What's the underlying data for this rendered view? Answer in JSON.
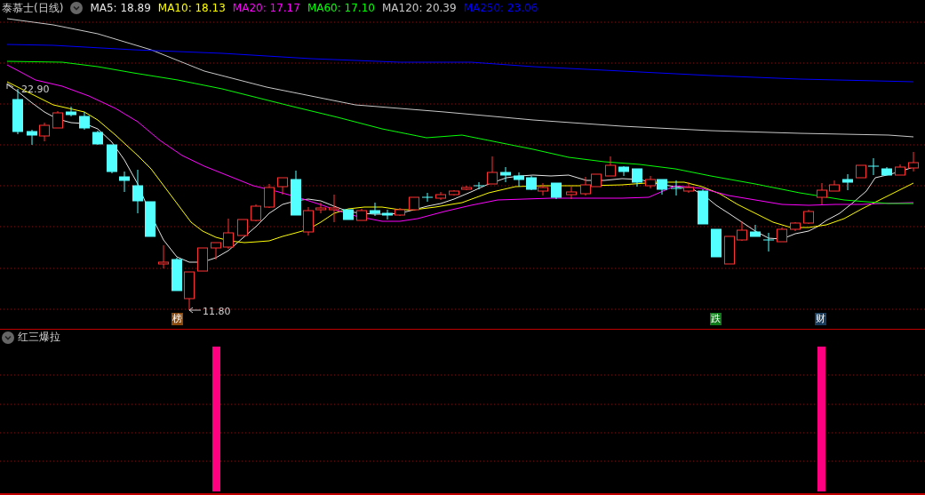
{
  "header": {
    "title": "泰慕士(日线)",
    "indicators": [
      {
        "label": "MA5: 18.89",
        "color": "#e6e6e6"
      },
      {
        "label": "MA10: 18.13",
        "color": "#ffff00"
      },
      {
        "label": "MA20: 17.17",
        "color": "#ff00ff"
      },
      {
        "label": "MA60: 17.10",
        "color": "#00ff00"
      },
      {
        "label": "MA120: 20.39",
        "color": "#c8c8c8"
      },
      {
        "label": "MA250: 23.06",
        "color": "#0000ff"
      }
    ]
  },
  "price_chart": {
    "high_label": "22.90",
    "low_label": "11.80",
    "badges": [
      {
        "text": "榜",
        "color": "#8a4a0e"
      },
      {
        "text": "跌",
        "color": "#0f7a1a"
      },
      {
        "text": "财",
        "color": "#1a3c5c"
      }
    ]
  },
  "indicator_panel": {
    "title": "红三爆拉"
  }
}
